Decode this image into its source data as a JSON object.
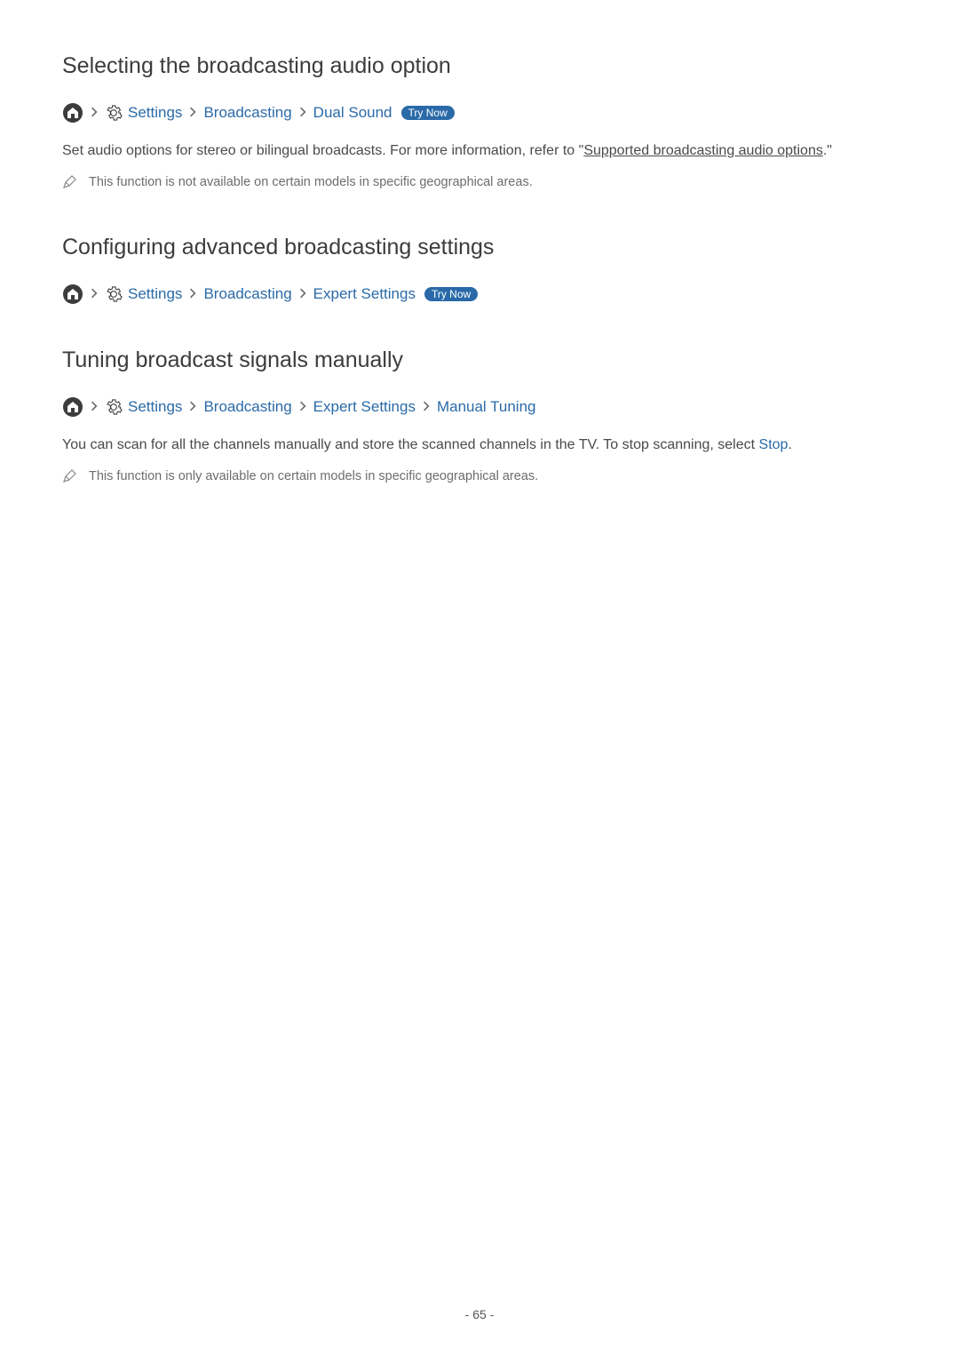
{
  "sections": [
    {
      "heading": "Selecting the broadcasting audio option",
      "breadcrumb": {
        "items": [
          "Settings",
          "Broadcasting",
          "Dual Sound"
        ],
        "try_now": "Try Now"
      },
      "body_prefix": "Set audio options for stereo or bilingual broadcasts. For more information, refer to \"",
      "body_link": "Supported broadcasting audio options",
      "body_suffix": ".\"",
      "note": "This function is not available on certain models in specific geographical areas."
    },
    {
      "heading": "Configuring advanced broadcasting settings",
      "breadcrumb": {
        "items": [
          "Settings",
          "Broadcasting",
          "Expert Settings"
        ],
        "try_now": "Try Now"
      }
    },
    {
      "heading": "Tuning broadcast signals manually",
      "breadcrumb": {
        "items": [
          "Settings",
          "Broadcasting",
          "Expert Settings",
          "Manual Tuning"
        ]
      },
      "body_prefix": "You can scan for all the channels manually and store the scanned channels in the TV. To stop scanning, select ",
      "body_link_blue": "Stop",
      "body_suffix": ".",
      "note": "This function is only available on certain models in specific geographical areas."
    }
  ],
  "page_number": "- 65 -"
}
